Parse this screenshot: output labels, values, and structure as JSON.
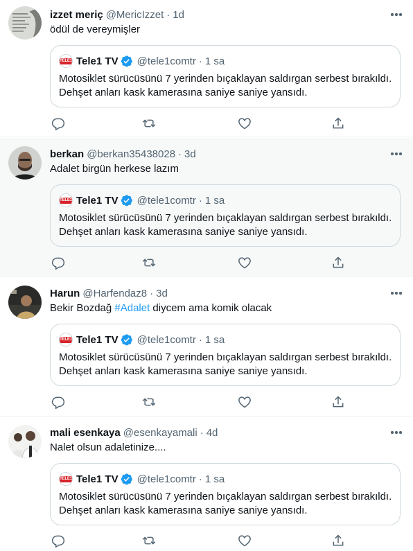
{
  "tweets": [
    {
      "name": "izzet meriç",
      "handle": "@MericIzzet",
      "time": "1d",
      "text": "ödül de vereymişler"
    },
    {
      "name": "berkan",
      "handle": "@berkan35438028",
      "time": "3d",
      "text": "Adalet birgün herkese lazım"
    },
    {
      "name": "Harun",
      "handle": "@Harfendaz8",
      "time": "3d",
      "text_before": "Bekir Bozdağ ",
      "hashtag": "#Adalet",
      "text_after": " diycem ama komik olacak"
    },
    {
      "name": "mali esenkaya",
      "handle": "@esenkayamali",
      "time": "4d",
      "text": "Nalet olsun adaletinize...."
    }
  ],
  "quoted": {
    "logo_text": "TELE1",
    "name": "Tele1 TV",
    "handle": "@tele1comtr",
    "time": "1 sa",
    "line1": "Motosiklet sürücüsünü 7 yerinden bıçaklayan saldırgan serbest bırakıldı.",
    "line2": "Dehşet anları kask kamerasına saniye saniye yansıdı."
  },
  "separator": "·",
  "colors": {
    "accent": "#1d9bf0",
    "secondary_text": "#536471",
    "highlight_bg": "#f7f9f9",
    "logo_red": "#d8232a"
  },
  "icons": [
    "more-icon",
    "verified-icon",
    "reply-icon",
    "retweet-icon",
    "like-icon",
    "share-icon"
  ]
}
